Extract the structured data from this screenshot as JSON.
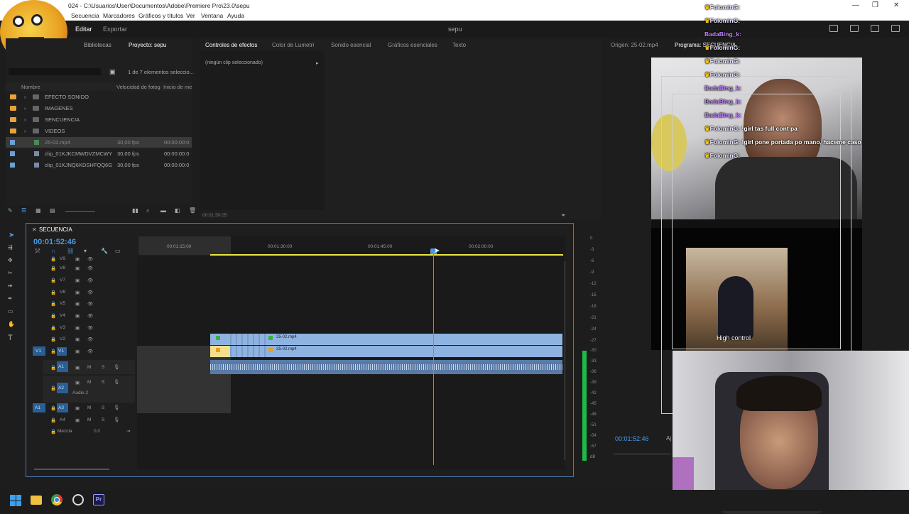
{
  "titlebar": {
    "title": "024 - C:\\Usuarios\\User\\Documentos\\Adobe\\Premiere Pro\\23.0\\sepu",
    "minimize": "—",
    "restore": "❐",
    "close": "✕"
  },
  "menubar": [
    "Secuencia",
    "Marcadores",
    "Gráficos y títulos",
    "Ver",
    "Ventana",
    "Ayuda"
  ],
  "header": {
    "tabs": [
      "Editar",
      "Exportar"
    ],
    "project_title": "sepu"
  },
  "project": {
    "tabs": [
      "Bibliotecas",
      "Proyecto: sepu"
    ],
    "count": "1 de 7 elementos seleccio...",
    "columns": [
      "Nombre",
      "Velocidad de fotog",
      "Inicio de me"
    ],
    "items": [
      {
        "name": "EFECTO SONIDO",
        "type": "folder"
      },
      {
        "name": "IMAGENES",
        "type": "folder"
      },
      {
        "name": "SENCUENCIA",
        "type": "folder"
      },
      {
        "name": "VIDEOS",
        "type": "folder"
      },
      {
        "name": "25-02.mp4",
        "type": "clip",
        "fps": "30,00 fps",
        "start": "00:00:00:0"
      },
      {
        "name": "clip_01KJKCMWDVZMCWY",
        "type": "clip",
        "fps": "30,00 fps",
        "start": "00:00:00:0"
      },
      {
        "name": "clip_01KJNQ6KDSHFQQ6G",
        "type": "clip",
        "fps": "30,00 fps",
        "start": "00:00:00:0"
      }
    ]
  },
  "effects": {
    "tabs": [
      "Controles de efectos",
      "Color de Lumetri",
      "Sonido esencial",
      "Gráficos esenciales",
      "Texto"
    ],
    "no_clip": "(ningún clip seleccionado)",
    "timecode": "00:01:50:05"
  },
  "monitor": {
    "source_tab": "Origen: 25-02.mp4",
    "program_tab": "Programa: SECUENCIA",
    "timecode": "00:01:52:46",
    "fit": "Aj"
  },
  "timeline": {
    "name": "SECUENCIA",
    "timecode": "00:01:52:46",
    "ruler": [
      "00:01:15:00",
      "00:01:30:00",
      "00:01:45:00",
      "00:02:00:00"
    ],
    "video_tracks": [
      "V9",
      "V8",
      "V7",
      "V6",
      "V5",
      "V4",
      "V3",
      "V2",
      "V1"
    ],
    "audio_tracks": [
      "A1",
      "A2",
      "A3",
      "A4"
    ],
    "audio2_label": "Audio 2",
    "mix_label": "Mezcla",
    "mix_value": "0,0",
    "src_v1": "V1",
    "src_a1": "A1",
    "clip_v2": "25-02.mp4",
    "clip_v1": "25-02.mp4",
    "playhead_fraction": 0.69
  },
  "meters": [
    "0",
    "-3",
    "-6",
    "-9",
    "-12",
    "-15",
    "-18",
    "-21",
    "-24",
    "-27",
    "-30",
    "-33",
    "-36",
    "-39",
    "-42",
    "-45",
    "-48",
    "-51",
    "-54",
    "-57",
    "dB"
  ],
  "chat": [
    {
      "name": "FolominG:",
      "msg": "",
      "color": "#e9e4ff"
    },
    {
      "name": "FolominG:",
      "msg": "",
      "color": "#e9e4ff"
    },
    {
      "name": "BadaBing_k:",
      "msg": "",
      "color": "#c084fc"
    },
    {
      "name": "FolominG:",
      "msg": "",
      "color": "#e9e4ff"
    },
    {
      "name": "FolominG:",
      "msg": "",
      "color": "#e9e4ff"
    },
    {
      "name": "FolominG:",
      "msg": "",
      "color": "#e9e4ff"
    },
    {
      "name": "BadaBing_k:",
      "msg": "",
      "color": "#c084fc"
    },
    {
      "name": "BadaBing_k:",
      "msg": "",
      "color": "#c084fc"
    },
    {
      "name": "BadaBing_k:",
      "msg": "",
      "color": "#c084fc"
    },
    {
      "name": "FolominG:",
      "msg": "!girl tas full cont pa",
      "color": "#e9e4ff"
    },
    {
      "name": "FolominG:",
      "msg": "!girl pone portada po mano, haceme caso",
      "color": "#e9e4ff"
    },
    {
      "name": "FolominG:",
      "msg": "",
      "color": "#e9e4ff"
    }
  ],
  "overlay_caption": "High control",
  "colors": {
    "accent": "#2d8ceb",
    "clip": "#8fb3e0",
    "folder": "#e8a23a",
    "yellow": "#e9e640"
  }
}
